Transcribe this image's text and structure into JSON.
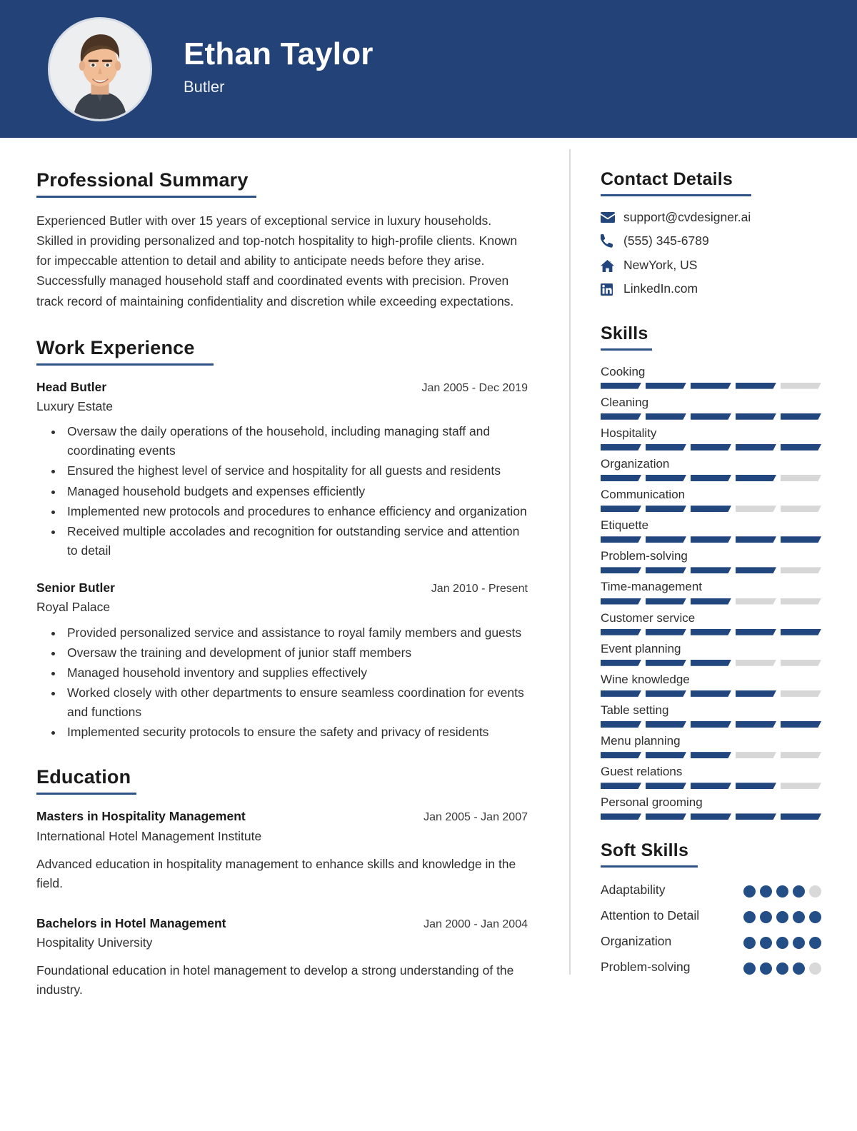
{
  "colors": {
    "header_bg": "#234277",
    "accent": "#2e5186",
    "bar_fill": "#22467e",
    "bar_empty": "#d7d7d7",
    "dot_fill": "#234e86",
    "dot_empty": "#d9d9d9"
  },
  "header": {
    "name": "Ethan Taylor",
    "role": "Butler"
  },
  "summary": {
    "heading": "Professional Summary",
    "text": "Experienced Butler with over 15 years of exceptional service in luxury households. Skilled in providing personalized and top-notch hospitality to high-profile clients. Known for impeccable attention to detail and ability to anticipate needs before they arise. Successfully managed household staff and coordinated events with precision. Proven track record of maintaining confidentiality and discretion while exceeding expectations."
  },
  "work": {
    "heading": "Work Experience",
    "entries": [
      {
        "title": "Head Butler",
        "org": "Luxury Estate",
        "date": "Jan 2005 - Dec 2019",
        "bullets": [
          "Oversaw the daily operations of the household, including managing staff and coordinating events",
          "Ensured the highest level of service and hospitality for all guests and residents",
          "Managed household budgets and expenses efficiently",
          "Implemented new protocols and procedures to enhance efficiency and organization",
          "Received multiple accolades and recognition for outstanding service and attention to detail"
        ]
      },
      {
        "title": "Senior Butler",
        "org": "Royal Palace",
        "date": "Jan 2010 - Present",
        "bullets": [
          "Provided personalized service and assistance to royal family members and guests",
          "Oversaw the training and development of junior staff members",
          "Managed household inventory and supplies effectively",
          "Worked closely with other departments to ensure seamless coordination for events and functions",
          "Implemented security protocols to ensure the safety and privacy of residents"
        ]
      }
    ]
  },
  "education": {
    "heading": "Education",
    "entries": [
      {
        "title": "Masters in Hospitality Management",
        "org": "International Hotel Management Institute",
        "date": "Jan 2005 - Jan 2007",
        "desc": "Advanced education in hospitality management to enhance skills and knowledge in the field."
      },
      {
        "title": "Bachelors in Hotel Management",
        "org": "Hospitality University",
        "date": "Jan 2000 - Jan 2004",
        "desc": "Foundational education in hotel management to develop a strong understanding of the industry."
      }
    ]
  },
  "contact": {
    "heading": "Contact Details",
    "items": [
      {
        "icon": "envelope-icon",
        "value": "support@cvdesigner.ai"
      },
      {
        "icon": "phone-icon",
        "value": "(555) 345-6789"
      },
      {
        "icon": "home-icon",
        "value": "NewYork, US"
      },
      {
        "icon": "linkedin-icon",
        "value": "LinkedIn.com"
      }
    ]
  },
  "skills": {
    "heading": "Skills",
    "max": 5,
    "items": [
      {
        "label": "Cooking",
        "level": 4
      },
      {
        "label": "Cleaning",
        "level": 5
      },
      {
        "label": "Hospitality",
        "level": 5
      },
      {
        "label": "Organization",
        "level": 4
      },
      {
        "label": "Communication",
        "level": 3
      },
      {
        "label": "Etiquette",
        "level": 5
      },
      {
        "label": "Problem-solving",
        "level": 4
      },
      {
        "label": "Time-management",
        "level": 3
      },
      {
        "label": "Customer service",
        "level": 5
      },
      {
        "label": "Event planning",
        "level": 3
      },
      {
        "label": "Wine knowledge",
        "level": 4
      },
      {
        "label": "Table setting",
        "level": 5
      },
      {
        "label": "Menu planning",
        "level": 3
      },
      {
        "label": "Guest relations",
        "level": 4
      },
      {
        "label": "Personal grooming",
        "level": 5
      }
    ]
  },
  "soft_skills": {
    "heading": "Soft Skills",
    "max": 5,
    "items": [
      {
        "label": "Adaptability",
        "level": 4
      },
      {
        "label": "Attention to Detail",
        "level": 5
      },
      {
        "label": "Organization",
        "level": 5
      },
      {
        "label": "Problem-solving",
        "level": 4
      }
    ]
  }
}
